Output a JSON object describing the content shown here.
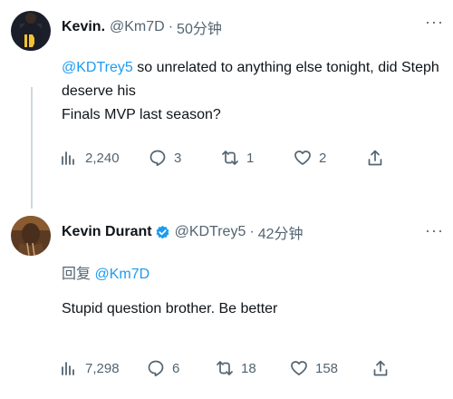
{
  "tweet1": {
    "display_name": "Kevin.",
    "handle": "@Km7D",
    "separator": "·",
    "time": "50分钟",
    "mention": "@KDTrey5",
    "text_line1": " so unrelated to anything else tonight, did Steph deserve his",
    "text_line2": "Finals MVP last season?",
    "views": "2,240",
    "replies": "3",
    "retweets": "1",
    "likes": "2"
  },
  "tweet2": {
    "display_name": "Kevin Durant",
    "handle": "@KDTrey5",
    "separator": "·",
    "time": "42分钟",
    "replying_prefix": "回复 ",
    "replying_to": "@Km7D",
    "text": "Stupid question brother. Be better",
    "views": "7,298",
    "replies": "6",
    "retweets": "18",
    "likes": "158"
  },
  "colors": {
    "link": "#1d9bf0",
    "secondary": "#536471",
    "verified": "#1d9bf0"
  }
}
